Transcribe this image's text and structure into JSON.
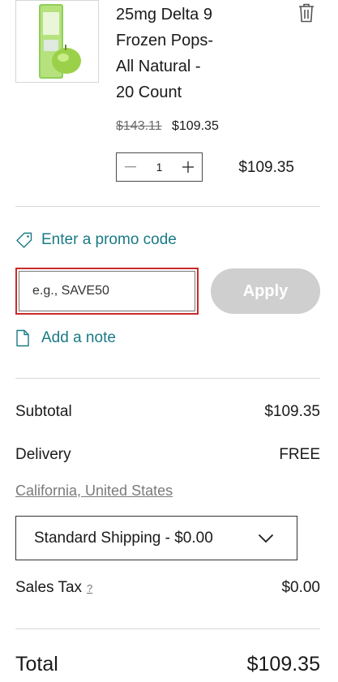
{
  "item": {
    "title_lines": [
      "25mg Delta 9",
      "Frozen Pops-",
      "All Natural -",
      "20 Count"
    ],
    "original_price": "$143.11",
    "sale_price": "$109.35",
    "quantity": "1",
    "line_total": "$109.35",
    "image_label": "THC FROZEN POP",
    "remove_icon": "trash-icon"
  },
  "promo": {
    "link_label": "Enter a promo code",
    "input_placeholder": "e.g., SAVE50",
    "apply_label": "Apply",
    "icon": "tag-icon"
  },
  "note": {
    "link_label": "Add a note",
    "icon": "document-icon"
  },
  "summary": {
    "subtotal_label": "Subtotal",
    "subtotal_value": "$109.35",
    "delivery_label": "Delivery",
    "delivery_value": "FREE",
    "location": "California, United States",
    "shipping_option": "Standard Shipping - $0.00",
    "tax_label": "Sales Tax",
    "tax_help": "?",
    "tax_value": "$0.00",
    "total_label": "Total",
    "total_value": "$109.35"
  },
  "colors": {
    "link": "#1a7a86",
    "apply_disabled": "#cfcfcf",
    "input_focus_border": "#c92a2a"
  }
}
